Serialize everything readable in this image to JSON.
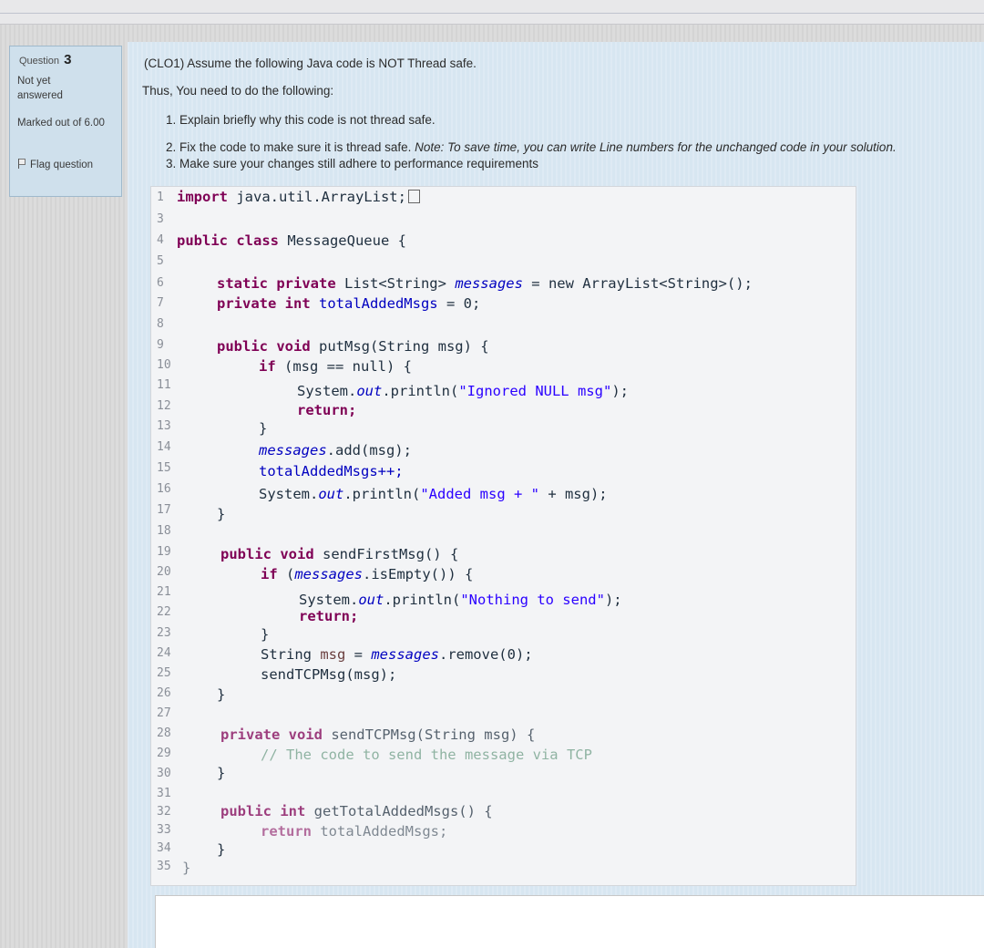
{
  "question": {
    "label": "Question",
    "number": "3",
    "state": "Not yet answered",
    "mark": "Marked out of 6.00",
    "flag": "Flag question"
  },
  "prompt": {
    "intro": "(CLO1) Assume the following Java code is NOT Thread safe.",
    "thus": "Thus, You need to do the following:",
    "item1": "1. Explain briefly why this code is not thread safe.",
    "item2_lead": "2. Fix the code to make sure it is thread safe. ",
    "item2_note": "Note: To save time, you can write Line numbers for the unchanged code in your solution.",
    "item3": "3. Make sure your changes still adhere to performance requirements"
  },
  "code": {
    "line_numbers": [
      "1",
      "3",
      "4",
      "5",
      "6",
      "7",
      "8",
      "9",
      "10",
      "11",
      "12",
      "13",
      "14",
      "15",
      "16",
      "17",
      "18",
      "19",
      "20",
      "21",
      "22",
      "23",
      "24",
      "25",
      "26",
      "27",
      "28",
      "29",
      "30",
      "31",
      "32",
      "33",
      "34",
      "35"
    ],
    "l1_kw": "import",
    "l1_rest": " java.util.ArrayList;",
    "l4_kw": "public class",
    "l4_rest": " MessageQueue {",
    "l6_kw": "static private",
    "l6_type": " List<String> ",
    "l6_field": "messages",
    "l6_rest": " = new ArrayList<String>();",
    "l7_kw": "private int",
    "l7_field": " totalAddedMsgs",
    "l7_rest": " = 0;",
    "l9_kw": "public void",
    "l9_rest": " putMsg(String msg) {",
    "l10_kw": "if",
    "l10_rest": " (msg == null) {",
    "l11_pre": "System.",
    "l11_out": "out",
    "l11_mid": ".println(",
    "l11_str": "\"Ignored NULL msg\"",
    "l11_end": ");",
    "l12": "return;",
    "l13": "}",
    "l14_field": "messages",
    "l14_rest": ".add(msg);",
    "l15": "totalAddedMsgs++;",
    "l16_pre": "System.",
    "l16_out": "out",
    "l16_mid": ".println(",
    "l16_str": "\"Added msg + \"",
    "l16_end": " + msg);",
    "l17": "}",
    "l19_kw": "public void",
    "l19_rest": " sendFirstMsg() {",
    "l20_kw": "if",
    "l20_pre": " (",
    "l20_field": "messages",
    "l20_rest": ".isEmpty()) {",
    "l21_pre": "System.",
    "l21_out": "out",
    "l21_mid": ".println(",
    "l21_str": "\"Nothing to send\"",
    "l21_end": ");",
    "l22": "return;",
    "l23": "}",
    "l24_type": "String ",
    "l24_var": "msg",
    "l24_eq": " = ",
    "l24_field": "messages",
    "l24_rest": ".remove(0);",
    "l25": "sendTCPMsg(msg);",
    "l26": "}",
    "l28_kw": "private void",
    "l28_rest": " sendTCPMsg(String msg) {",
    "l29": "// The code to send the message via TCP",
    "l30": "}",
    "l32_kw": "public int",
    "l32_rest": " getTotalAddedMsgs() {",
    "l33_kw": "return",
    "l33_rest": " totalAddedMsgs;",
    "l34": "}",
    "l35": "}"
  }
}
